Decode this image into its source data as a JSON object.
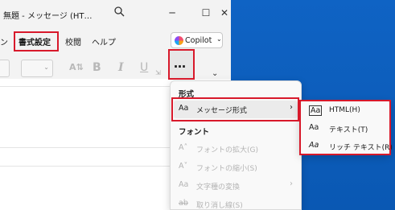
{
  "window": {
    "title": "無題 - メッセージ (HT…",
    "controls": {
      "search_icon": "search-icon",
      "minimize": "─",
      "maximize": "☐",
      "close": "✕"
    }
  },
  "menubar": {
    "cutoff": "ン",
    "format_text": "書式設定",
    "review": "校閲",
    "help": "ヘルプ",
    "copilot": "Copilot"
  },
  "toolbar": {
    "bold": "B",
    "italic": "I",
    "underline": "U",
    "more": "…"
  },
  "menu": {
    "section_format": "形式",
    "message_format": {
      "icon": "Aa",
      "label": "メッセージ形式",
      "arrow": "›"
    },
    "section_font": "フォント",
    "enlarge_font": {
      "icon": "A˄",
      "label": "フォントの拡大(G)"
    },
    "shrink_font": {
      "icon": "A˅",
      "label": "フォントの縮小(S)"
    },
    "change_case": {
      "icon": "Aa",
      "label": "文字種の変換",
      "arrow": "›"
    },
    "strikethrough": {
      "icon": "ab",
      "label": "取り消し線(S)"
    }
  },
  "submenu": {
    "html": {
      "icon": "Aa",
      "label": "HTML(H)"
    },
    "plain_text": {
      "icon": "Aa",
      "label": "テキスト(T)"
    },
    "rich_text": {
      "icon": "Aa",
      "label": "リッチ テキスト(R)"
    }
  },
  "colors": {
    "highlight_border": "#d8192b",
    "desktop": "#0e5fbd"
  }
}
